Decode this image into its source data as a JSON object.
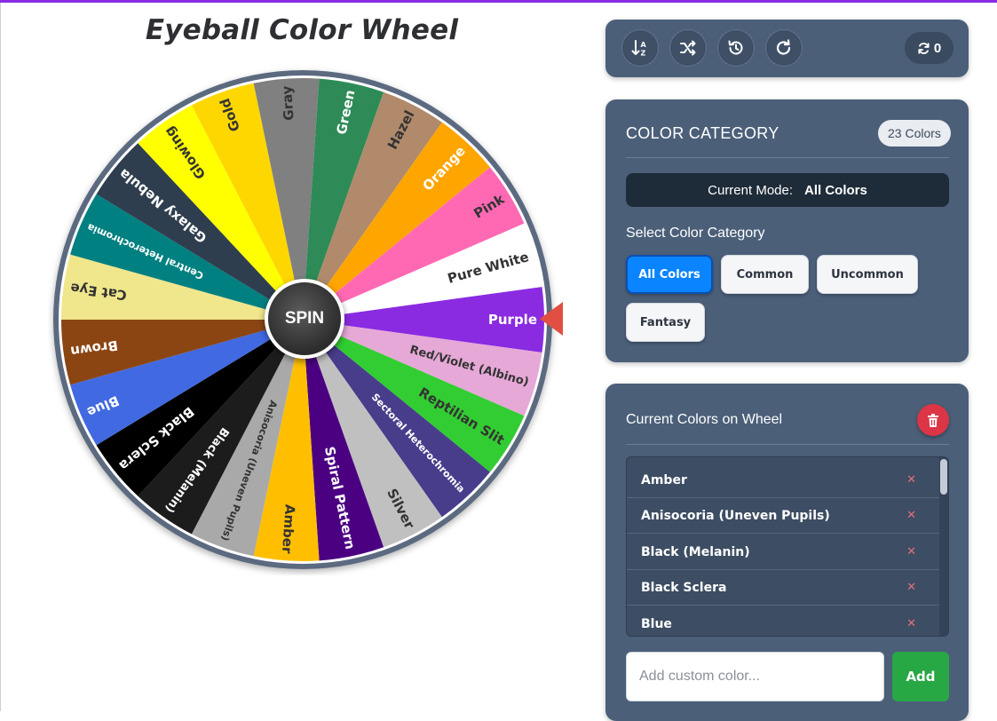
{
  "page": {
    "title": "Eyeball Color Wheel",
    "accent_top_bar": "#8a2be2"
  },
  "wheel": {
    "spin_label": "SPIN",
    "pointer_color": "#e04f41",
    "rim_color": "#5b6b80",
    "segments": [
      {
        "label": "Purple",
        "color": "#8a2be2",
        "text": "#ffffff"
      },
      {
        "label": "Red/Violet (Albino)",
        "color": "#e6a8d7",
        "text": "#333333"
      },
      {
        "label": "Reptilian Slit",
        "color": "#32cd32",
        "text": "#333333"
      },
      {
        "label": "Sectoral Heterochromia",
        "color": "#483d8b",
        "text": "#ffffff"
      },
      {
        "label": "Silver",
        "color": "#c0c0c0",
        "text": "#333333"
      },
      {
        "label": "Spiral Pattern",
        "color": "#4b0082",
        "text": "#ffffff"
      },
      {
        "label": "Amber",
        "color": "#ffbf00",
        "text": "#333333"
      },
      {
        "label": "Anisocoria (Uneven Pupils)",
        "color": "#a9a9a9",
        "text": "#333333"
      },
      {
        "label": "Black (Melanin)",
        "color": "#1c1c1c",
        "text": "#ffffff"
      },
      {
        "label": "Black Sclera",
        "color": "#000000",
        "text": "#ffffff"
      },
      {
        "label": "Blue",
        "color": "#4169e1",
        "text": "#ffffff"
      },
      {
        "label": "Brown",
        "color": "#8b4513",
        "text": "#ffffff"
      },
      {
        "label": "Cat Eye",
        "color": "#f0e68c",
        "text": "#333333"
      },
      {
        "label": "Central Heterochromia",
        "color": "#008080",
        "text": "#ffffff"
      },
      {
        "label": "Galaxy Nebula",
        "color": "#2f3e4f",
        "text": "#ffffff"
      },
      {
        "label": "Glowing",
        "color": "#ffff00",
        "text": "#333333"
      },
      {
        "label": "Gold",
        "color": "#ffd700",
        "text": "#333333"
      },
      {
        "label": "Gray",
        "color": "#808080",
        "text": "#333333"
      },
      {
        "label": "Green",
        "color": "#2e8b57",
        "text": "#ffffff"
      },
      {
        "label": "Hazel",
        "color": "#b08a6b",
        "text": "#333333"
      },
      {
        "label": "Orange",
        "color": "#ffa500",
        "text": "#ffffff"
      },
      {
        "label": "Pink",
        "color": "#ff69b4",
        "text": "#333333"
      },
      {
        "label": "Pure White",
        "color": "#ffffff",
        "text": "#333333"
      }
    ]
  },
  "toolbar": {
    "buttons": [
      {
        "name": "sort-button",
        "icon": "sort-alpha-icon"
      },
      {
        "name": "shuffle-button",
        "icon": "shuffle-icon"
      },
      {
        "name": "history-button",
        "icon": "history-icon"
      },
      {
        "name": "redo-button",
        "icon": "redo-icon"
      }
    ],
    "spin_count": "0"
  },
  "category": {
    "title": "COLOR CATEGORY",
    "count_badge": "23 Colors",
    "mode_label": "Current Mode:",
    "mode_value": "All Colors",
    "select_label": "Select Color Category",
    "buttons": [
      "All Colors",
      "Common",
      "Uncommon",
      "Fantasy"
    ],
    "active_button": "All Colors"
  },
  "current_colors": {
    "title": "Current Colors on Wheel",
    "items": [
      "Amber",
      "Anisocoria (Uneven Pupils)",
      "Black (Melanin)",
      "Black Sclera",
      "Blue"
    ],
    "remove_glyph": "✕",
    "input_placeholder": "Add custom color...",
    "add_label": "Add"
  }
}
